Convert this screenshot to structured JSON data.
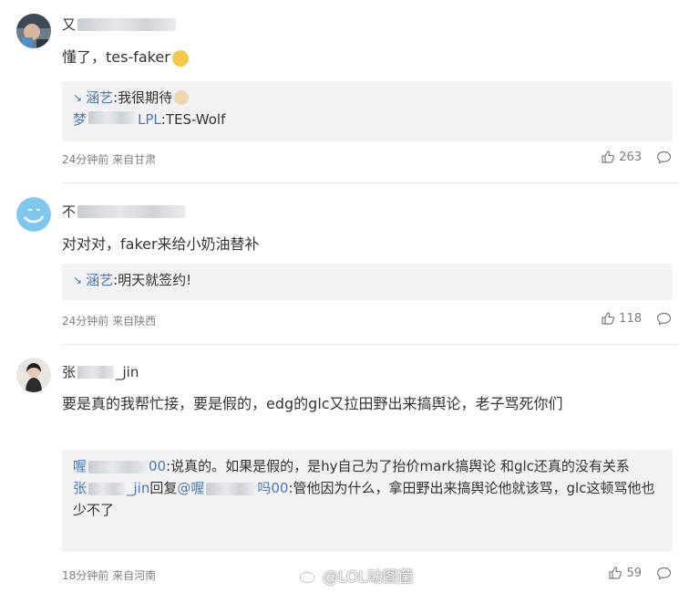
{
  "comments": [
    {
      "name_prefix": "又",
      "text": "懂了，tes-faker",
      "replies": [
        {
          "user": "涵艺",
          "text": ":我很期待"
        },
        {
          "user_prefix": "梦",
          "user_suffix": "LPL",
          "text": ":TES-Wolf"
        }
      ],
      "time": "24分钟前 来自甘肃",
      "likes": "263"
    },
    {
      "name_prefix": "不",
      "text": "对对对，faker来给小奶油替补",
      "replies": [
        {
          "user": "涵艺",
          "text": ":明天就签约!"
        }
      ],
      "time": "24分钟前 来自陕西",
      "likes": "118"
    },
    {
      "name_prefix": "张",
      "name_suffix": "_jin",
      "text": "要是真的我帮忙接，要是假的，edg的glc又拉田野出来搞舆论，老子骂死你们",
      "replies": [
        {
          "user_prefix": "喔",
          "user_suffix": "00",
          "text": ":说真的。如果是假的，是hy自己为了抬价mark搞舆论 和glc还真的没有关系"
        },
        {
          "user_prefix": "张",
          "user_suffix": "_jin",
          "reply_word": "回复",
          "mention_prefix": "@喔",
          "mention_suffix": "吗00",
          "text": ":管他因为什么，拿田野出来搞舆论他就该骂，glc这顿骂他也少不了"
        }
      ],
      "time": "18分钟前 来自河南",
      "likes": "59"
    }
  ],
  "watermark": "@LOL动图菌",
  "colors": {
    "link": "#4a78b5",
    "meta": "#808080",
    "quote_bg": "#f2f2f5"
  },
  "icons": {
    "reply_prefix": "↘",
    "like": "thumbs-up-icon",
    "comment": "comment-bubble-icon"
  }
}
